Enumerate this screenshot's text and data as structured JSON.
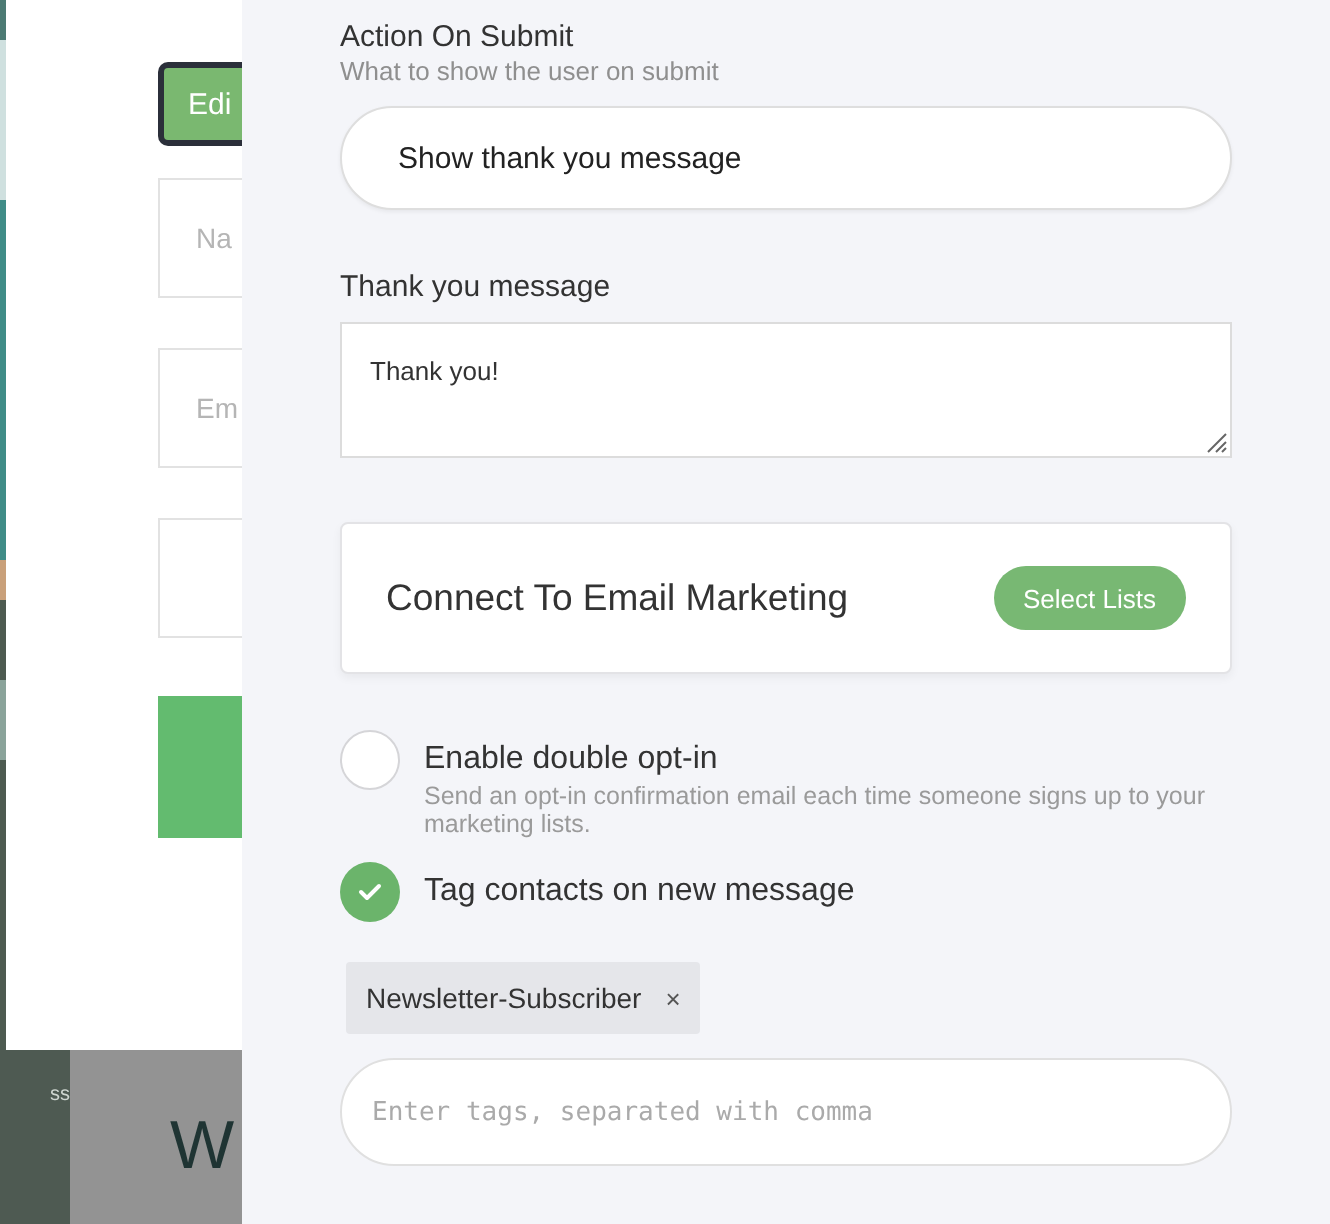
{
  "preview": {
    "edit_button": "Edi",
    "fields": [
      {
        "placeholder": "Na"
      },
      {
        "placeholder": "Em"
      }
    ],
    "footer_texts": [
      "ss",
      "W"
    ]
  },
  "action_on_submit": {
    "label": "Action On Submit",
    "hint": "What to show the user on submit",
    "value": "Show thank you message"
  },
  "thank_you": {
    "label": "Thank you message",
    "value": "Thank you!"
  },
  "email_marketing": {
    "title": "Connect To Email Marketing",
    "button": "Select Lists"
  },
  "options": [
    {
      "label": "Enable double opt-in",
      "description": "Send an opt-in confirmation email each time someone signs up to your marketing lists.",
      "checked": false
    },
    {
      "label": "Tag contacts on new message",
      "checked": true
    }
  ],
  "tags": [
    {
      "label": "Newsletter-Subscriber",
      "remove": "×"
    }
  ],
  "tag_input": {
    "placeholder": "Enter tags, separated with comma"
  }
}
